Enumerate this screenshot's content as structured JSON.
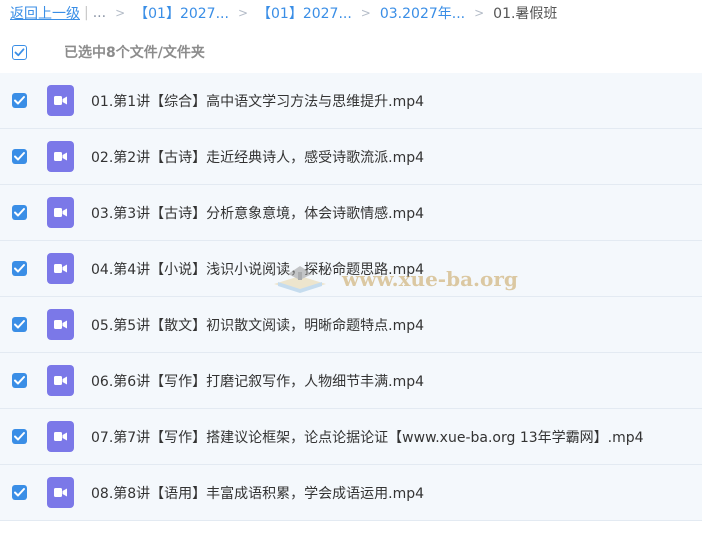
{
  "breadcrumb": {
    "back_label": "返回上一级",
    "ellipsis": "...",
    "items": [
      "【01】2027...",
      "【01】2027...",
      "03.2027年..."
    ],
    "current": "01.暑假班"
  },
  "selection": {
    "summary": "已选中8个文件/文件夹"
  },
  "files": [
    {
      "name": "01.第1讲【综合】高中语文学习方法与思维提升.mp4",
      "checked": true,
      "icon": "video-file-icon"
    },
    {
      "name": "02.第2讲【古诗】走近经典诗人，感受诗歌流派.mp4",
      "checked": true,
      "icon": "video-file-icon"
    },
    {
      "name": "03.第3讲【古诗】分析意象意境，体会诗歌情感.mp4",
      "checked": true,
      "icon": "video-file-icon"
    },
    {
      "name": "04.第4讲【小说】浅识小说阅读，探秘命题思路.mp4",
      "checked": true,
      "icon": "video-file-icon"
    },
    {
      "name": "05.第5讲【散文】初识散文阅读，明晰命题特点.mp4",
      "checked": true,
      "icon": "video-file-icon"
    },
    {
      "name": "06.第6讲【写作】打磨记叙写作，人物细节丰满.mp4",
      "checked": true,
      "icon": "video-file-icon"
    },
    {
      "name": "07.第7讲【写作】搭建议论框架，论点论据论证【www.xue-ba.org 13年学霸网】.mp4",
      "checked": true,
      "icon": "video-file-icon"
    },
    {
      "name": "08.第8讲【语用】丰富成语积累，学会成语运用.mp4",
      "checked": true,
      "icon": "video-file-icon"
    }
  ],
  "watermark": {
    "text": "www.xue-ba.org"
  },
  "colors": {
    "accent": "#3a8ee6",
    "video_icon": "#7b78e8",
    "row_bg": "#f4f8fc"
  }
}
